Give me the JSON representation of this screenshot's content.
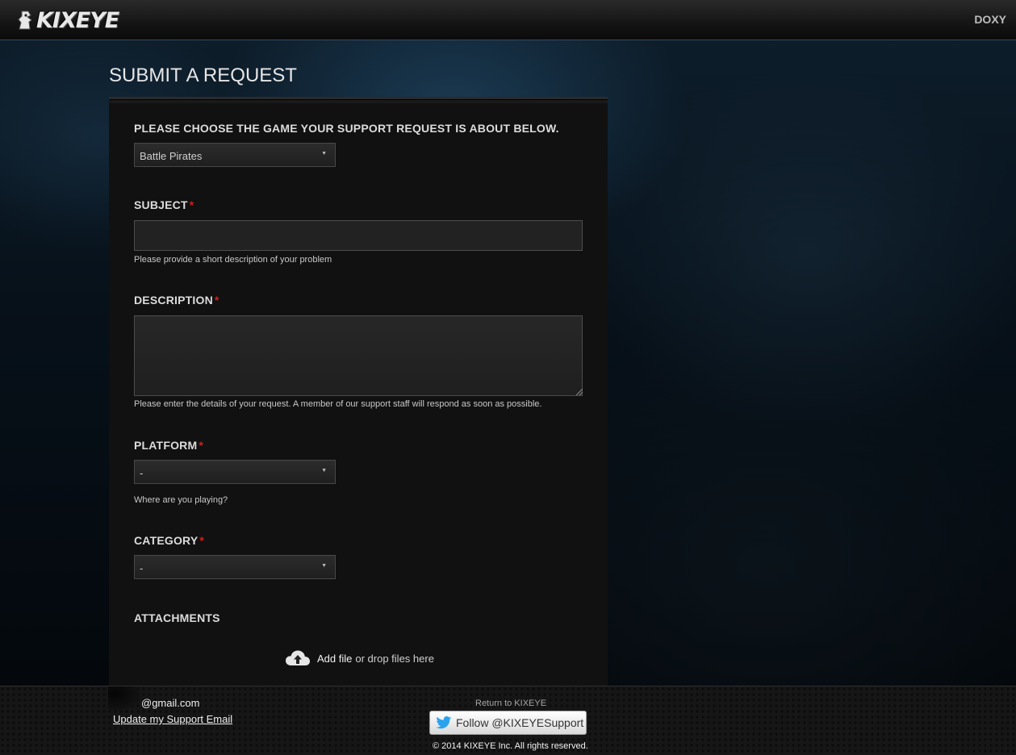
{
  "header": {
    "logo_text": "KIXEYE",
    "user_name": "DOXY"
  },
  "page": {
    "title": "SUBMIT A REQUEST"
  },
  "form": {
    "game": {
      "label": "PLEASE CHOOSE THE GAME YOUR SUPPORT REQUEST IS ABOUT BELOW.",
      "selected": "Battle Pirates"
    },
    "subject": {
      "label": "SUBJECT",
      "required_mark": "*",
      "value": "",
      "hint": "Please provide a short description of your problem"
    },
    "description": {
      "label": "DESCRIPTION",
      "required_mark": "*",
      "value": "",
      "hint": "Please enter the details of your request. A member of our support staff will respond as soon as possible."
    },
    "platform": {
      "label": "PLATFORM",
      "required_mark": "*",
      "selected": "-",
      "hint": "Where are you playing?"
    },
    "category": {
      "label": "CATEGORY",
      "required_mark": "*",
      "selected": "-"
    },
    "attachments": {
      "label": "ATTACHMENTS",
      "add_file": "Add file",
      "drop_text": "or drop files here"
    }
  },
  "footer": {
    "email": "@gmail.com",
    "update_email": "Update my Support Email",
    "return_link": "Return to KIXEYE",
    "follow_button": "Follow @KIXEYESupport",
    "copyright": "© 2014 KIXEYE Inc. All rights reserved."
  },
  "colors": {
    "required": "#d11f1f",
    "twitter": "#2aa3ef"
  },
  "icons": {
    "upload": "cloud-upload-icon",
    "twitter": "twitter-bird-icon",
    "caret": "chevron-down-icon",
    "logo": "kixeye-logo-icon"
  }
}
